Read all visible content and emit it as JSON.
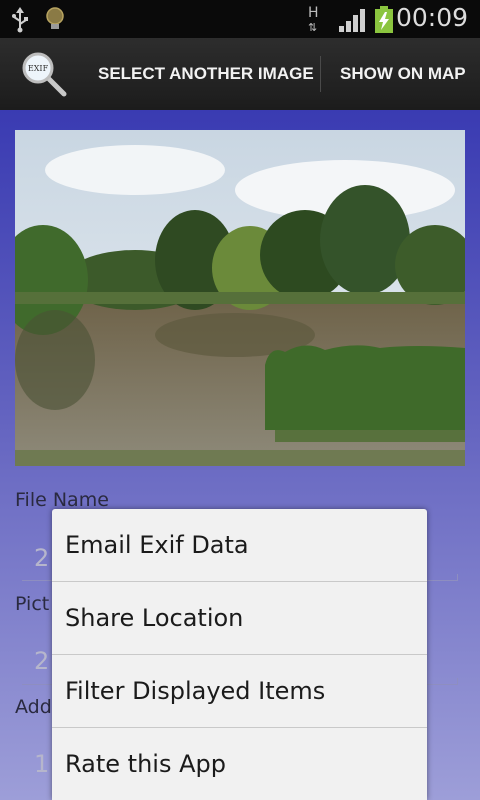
{
  "status_bar": {
    "network_type": "H",
    "time": "00:09",
    "battery_color": "#8bc53f",
    "icons": [
      "usb-icon",
      "lightbulb-icon",
      "network-h-icon",
      "signal-icon",
      "battery-charging-icon"
    ]
  },
  "action_bar": {
    "app_icon": "magnifier-exif-icon",
    "app_icon_text": "EXIF",
    "select_label": "SELECT ANOTHER IMAGE",
    "map_label": "SHOW ON MAP"
  },
  "content": {
    "image": "lake-landscape-photo",
    "fields": [
      {
        "label": "File Name",
        "value": "2"
      },
      {
        "label": "Pict",
        "value": "2"
      },
      {
        "label": "Add",
        "value": "1"
      }
    ]
  },
  "popup_menu": {
    "items": [
      {
        "label": "Email Exif Data"
      },
      {
        "label": "Share Location"
      },
      {
        "label": "Filter Displayed Items"
      },
      {
        "label": "Rate this App"
      }
    ]
  }
}
